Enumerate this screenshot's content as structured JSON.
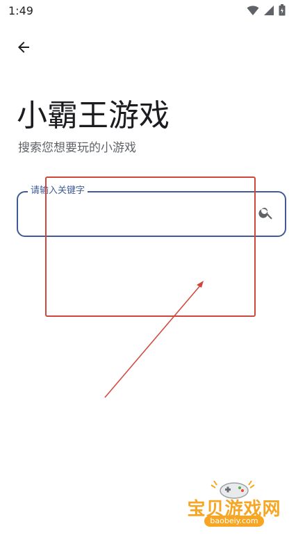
{
  "status_bar": {
    "time": "1:49",
    "icons": [
      "wifi-icon",
      "signal-icon",
      "battery-icon"
    ]
  },
  "header": {
    "back_icon": "arrow-left-icon"
  },
  "main": {
    "title": "小霸王游戏",
    "subtitle": "搜索您想要玩的小游戏",
    "search": {
      "label": "请输入关键字",
      "value": "",
      "placeholder": "",
      "icon": "search-icon"
    }
  },
  "watermark": {
    "text": "宝贝游戏网",
    "url": "baobeiy.com"
  },
  "colors": {
    "accent": "#3f5a96",
    "annotation": "#d0463b",
    "watermark": "#f6a623"
  }
}
